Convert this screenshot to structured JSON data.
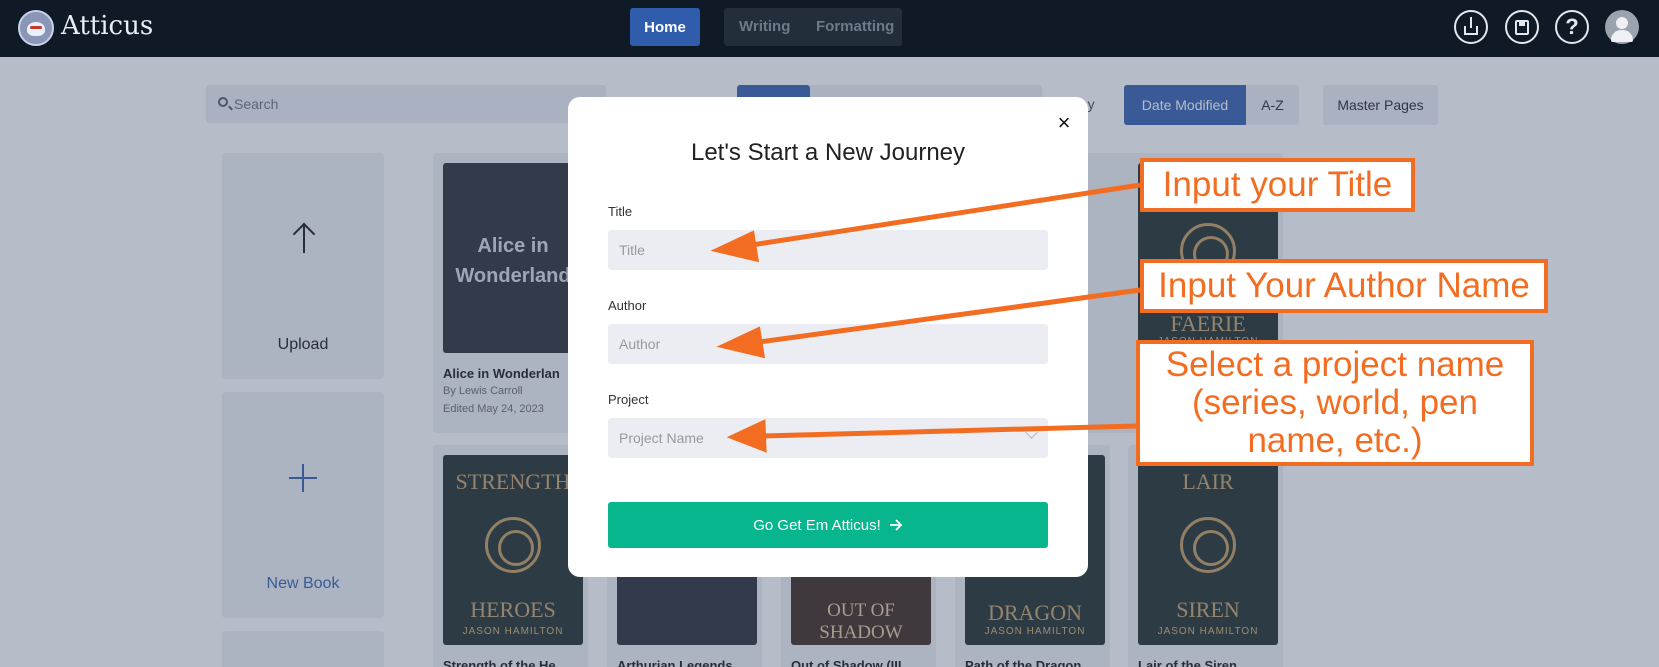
{
  "app": {
    "name": "Atticus"
  },
  "topnav": {
    "home": "Home",
    "writing": "Writing",
    "formatting": "Formatting"
  },
  "header_icons": [
    "export-icon",
    "save-icon",
    "help-icon",
    "avatar-icon"
  ],
  "toolbar": {
    "search_placeholder": "Search",
    "sort_label": "t by",
    "sort_date_modified": "Date Modified",
    "sort_az": "A-Z",
    "master_pages": "Master Pages"
  },
  "tiles": {
    "upload": "Upload",
    "new_book": "New Book"
  },
  "books": [
    {
      "cover_text": "Alice in Wonderland",
      "title": "Alice in Wonderlan",
      "author": "By Lewis Carroll",
      "edited": "Edited May 24, 2023"
    },
    {
      "cover_text": "FAERIE",
      "cover_sub": "JASON HAMILTON"
    },
    {
      "cover_text": "STRENGTH OF THE HEROES",
      "cover_top": "STRENGTH",
      "cover_bottom": "HEROES",
      "cover_sub": "JASON HAMILTON",
      "title": "Strength of the He"
    },
    {
      "title": "Arthurian Legends"
    },
    {
      "cover_text": "OUT OF SHADOW",
      "title": "Out of Shadow (III"
    },
    {
      "cover_text": "DRAGON",
      "cover_sub": "JASON HAMILTON",
      "title": "Path of the Dragon"
    },
    {
      "cover_text": "LAIR OF THE SIREN",
      "cover_top": "LAIR",
      "cover_bottom": "SIREN",
      "cover_sub": "JASON HAMILTON",
      "title": "Lair of the Siren"
    }
  ],
  "modal": {
    "title": "Let's Start a New Journey",
    "close": "×",
    "title_label": "Title",
    "title_placeholder": "Title",
    "author_label": "Author",
    "author_placeholder": "Author",
    "project_label": "Project",
    "project_placeholder": "Project Name",
    "submit": "Go Get Em Atticus!",
    "submit_icon": "arrow-right-icon"
  },
  "annotations": {
    "title_note": "Input your Title",
    "author_note": "Input Your Author Name",
    "project_note": "Select a project name (series, world, pen name, etc.)",
    "color": "#f26d21"
  },
  "colors": {
    "primary": "#2f5dac",
    "accent": "#07b68c",
    "topbar": "#0f1a26"
  }
}
